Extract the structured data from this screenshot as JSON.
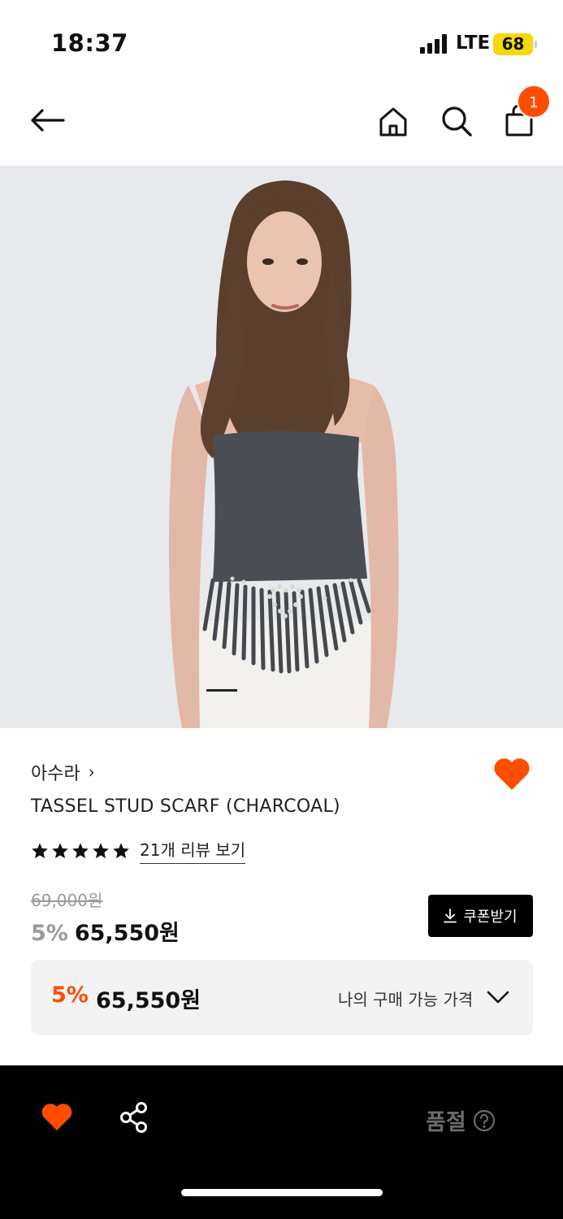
{
  "status": {
    "time": "18:37",
    "network": "LTE",
    "battery": "68"
  },
  "nav": {
    "cart_count": "1"
  },
  "product": {
    "brand": "아수라",
    "brand_chevron": "›",
    "title": "TASSEL STUD SCARF (CHARCOAL)",
    "rating_stars": 5,
    "review_link": "21개 리뷰 보기",
    "original_price": "69,000원",
    "discount_pct": "5%",
    "sale_price": "65,550원",
    "coupon_label": "쿠폰받기",
    "image_index": 1
  },
  "my_price": {
    "discount_pct": "5%",
    "price": "65,550원",
    "label": "나의 구매 가능 가격"
  },
  "bottom_bar": {
    "status": "품절"
  },
  "colors": {
    "accent": "#ff4d00",
    "badge_battery": "#f5d90a",
    "bar_bg": "#000000"
  },
  "icons": [
    "back-arrow-icon",
    "home-icon",
    "search-icon",
    "shopping-bag-icon",
    "heart-icon",
    "star-icon",
    "download-icon",
    "chevron-down-icon",
    "share-icon",
    "help-icon"
  ]
}
